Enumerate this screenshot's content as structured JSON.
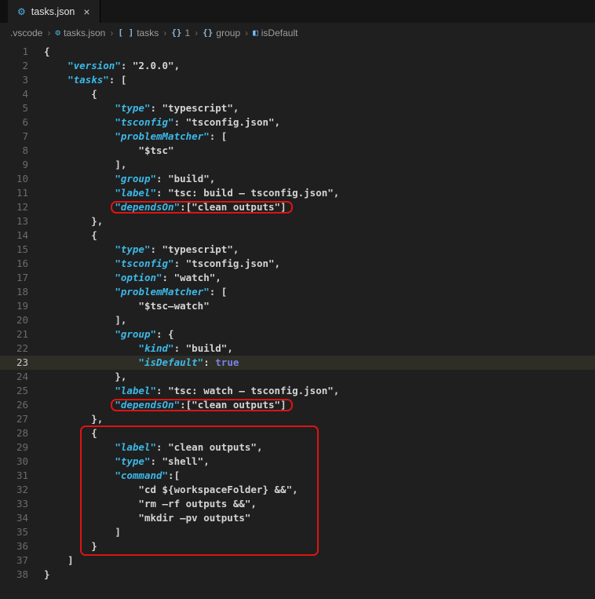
{
  "colors": {
    "background": "#1f1f1f",
    "tabbar_bg": "#161616",
    "tab_bg": "#1f1f1f",
    "key": "#3cb9e8",
    "text": "#d4d4d4",
    "keyword": "#7b82e4",
    "line_number": "#6b6b6b",
    "active_line_bg": "#2e2e27",
    "annotation": "#dd1414",
    "breadcrumb_text": "#9d9d9d"
  },
  "tab": {
    "label": "tasks.json",
    "close_glyph": "×",
    "icon_glyph": "⚙"
  },
  "breadcrumb": {
    "separator": "›",
    "items": [
      {
        "label": ".vscode",
        "icon": "",
        "icon_glyph": "",
        "icon_color": ""
      },
      {
        "label": "tasks.json",
        "icon": "json-file-icon",
        "icon_glyph": "⚙",
        "icon_color": "#4fb4e8"
      },
      {
        "label": "tasks",
        "icon": "symbol-array-icon",
        "icon_glyph": "[ ]",
        "icon_color": "#8ab6d6"
      },
      {
        "label": "1",
        "icon": "symbol-object-icon",
        "icon_glyph": "{}",
        "icon_color": "#8ab6d6"
      },
      {
        "label": "group",
        "icon": "symbol-object-icon",
        "icon_glyph": "{}",
        "icon_color": "#8ab6d6"
      },
      {
        "label": "isDefault",
        "icon": "symbol-boolean-icon",
        "icon_glyph": "◧",
        "icon_color": "#75beff"
      }
    ]
  },
  "editor": {
    "active_line": 23,
    "lines": [
      {
        "n": 1,
        "indent": 0,
        "segs": [
          [
            "p",
            "{"
          ]
        ]
      },
      {
        "n": 2,
        "indent": 4,
        "segs": [
          [
            "k",
            "\"version\""
          ],
          [
            "p",
            ": "
          ],
          [
            "s",
            "\"2.0.0\""
          ],
          [
            "p",
            ","
          ]
        ]
      },
      {
        "n": 3,
        "indent": 4,
        "segs": [
          [
            "k",
            "\"tasks\""
          ],
          [
            "p",
            ": ["
          ]
        ]
      },
      {
        "n": 4,
        "indent": 8,
        "segs": [
          [
            "p",
            "{"
          ]
        ]
      },
      {
        "n": 5,
        "indent": 12,
        "segs": [
          [
            "k",
            "\"type\""
          ],
          [
            "p",
            ": "
          ],
          [
            "s",
            "\"typescript\""
          ],
          [
            "p",
            ","
          ]
        ]
      },
      {
        "n": 6,
        "indent": 12,
        "segs": [
          [
            "k",
            "\"tsconfig\""
          ],
          [
            "p",
            ": "
          ],
          [
            "s",
            "\"tsconfig.json\""
          ],
          [
            "p",
            ","
          ]
        ]
      },
      {
        "n": 7,
        "indent": 12,
        "segs": [
          [
            "k",
            "\"problemMatcher\""
          ],
          [
            "p",
            ": ["
          ]
        ]
      },
      {
        "n": 8,
        "indent": 16,
        "segs": [
          [
            "s",
            "\"$tsc\""
          ]
        ]
      },
      {
        "n": 9,
        "indent": 12,
        "segs": [
          [
            "p",
            "],"
          ]
        ]
      },
      {
        "n": 10,
        "indent": 12,
        "segs": [
          [
            "k",
            "\"group\""
          ],
          [
            "p",
            ": "
          ],
          [
            "s",
            "\"build\""
          ],
          [
            "p",
            ","
          ]
        ]
      },
      {
        "n": 11,
        "indent": 12,
        "segs": [
          [
            "k",
            "\"label\""
          ],
          [
            "p",
            ": "
          ],
          [
            "s",
            "\"tsc: build — tsconfig.json\""
          ],
          [
            "p",
            ","
          ]
        ]
      },
      {
        "n": 12,
        "indent": 12,
        "segs": [
          [
            "k",
            "\"dependsOn\""
          ],
          [
            "p",
            ":["
          ],
          [
            "s",
            "\"clean outputs\""
          ],
          [
            "p",
            "]"
          ]
        ]
      },
      {
        "n": 13,
        "indent": 8,
        "segs": [
          [
            "p",
            "},"
          ]
        ]
      },
      {
        "n": 14,
        "indent": 8,
        "segs": [
          [
            "p",
            "{"
          ]
        ]
      },
      {
        "n": 15,
        "indent": 12,
        "segs": [
          [
            "k",
            "\"type\""
          ],
          [
            "p",
            ": "
          ],
          [
            "s",
            "\"typescript\""
          ],
          [
            "p",
            ","
          ]
        ]
      },
      {
        "n": 16,
        "indent": 12,
        "segs": [
          [
            "k",
            "\"tsconfig\""
          ],
          [
            "p",
            ": "
          ],
          [
            "s",
            "\"tsconfig.json\""
          ],
          [
            "p",
            ","
          ]
        ]
      },
      {
        "n": 17,
        "indent": 12,
        "segs": [
          [
            "k",
            "\"option\""
          ],
          [
            "p",
            ": "
          ],
          [
            "s",
            "\"watch\""
          ],
          [
            "p",
            ","
          ]
        ]
      },
      {
        "n": 18,
        "indent": 12,
        "segs": [
          [
            "k",
            "\"problemMatcher\""
          ],
          [
            "p",
            ": ["
          ]
        ]
      },
      {
        "n": 19,
        "indent": 16,
        "segs": [
          [
            "s",
            "\"$tsc—watch\""
          ]
        ]
      },
      {
        "n": 20,
        "indent": 12,
        "segs": [
          [
            "p",
            "],"
          ]
        ]
      },
      {
        "n": 21,
        "indent": 12,
        "segs": [
          [
            "k",
            "\"group\""
          ],
          [
            "p",
            ": {"
          ]
        ]
      },
      {
        "n": 22,
        "indent": 16,
        "segs": [
          [
            "k",
            "\"kind\""
          ],
          [
            "p",
            ": "
          ],
          [
            "s",
            "\"build\""
          ],
          [
            "p",
            ","
          ]
        ]
      },
      {
        "n": 23,
        "indent": 16,
        "segs": [
          [
            "k",
            "\"isDefault\""
          ],
          [
            "p",
            ": "
          ],
          [
            "w",
            "true"
          ]
        ]
      },
      {
        "n": 24,
        "indent": 12,
        "segs": [
          [
            "p",
            "},"
          ]
        ]
      },
      {
        "n": 25,
        "indent": 12,
        "segs": [
          [
            "k",
            "\"label\""
          ],
          [
            "p",
            ": "
          ],
          [
            "s",
            "\"tsc: watch — tsconfig.json\""
          ],
          [
            "p",
            ","
          ]
        ]
      },
      {
        "n": 26,
        "indent": 12,
        "segs": [
          [
            "k",
            "\"dependsOn\""
          ],
          [
            "p",
            ":["
          ],
          [
            "s",
            "\"clean outputs\""
          ],
          [
            "p",
            "]"
          ]
        ]
      },
      {
        "n": 27,
        "indent": 8,
        "segs": [
          [
            "p",
            "},"
          ]
        ]
      },
      {
        "n": 28,
        "indent": 8,
        "segs": [
          [
            "p",
            "{"
          ]
        ]
      },
      {
        "n": 29,
        "indent": 12,
        "segs": [
          [
            "k",
            "\"label\""
          ],
          [
            "p",
            ": "
          ],
          [
            "s",
            "\"clean outputs\""
          ],
          [
            "p",
            ","
          ]
        ]
      },
      {
        "n": 30,
        "indent": 12,
        "segs": [
          [
            "k",
            "\"type\""
          ],
          [
            "p",
            ": "
          ],
          [
            "s",
            "\"shell\""
          ],
          [
            "p",
            ","
          ]
        ]
      },
      {
        "n": 31,
        "indent": 12,
        "segs": [
          [
            "k",
            "\"command\""
          ],
          [
            "p",
            ":["
          ]
        ]
      },
      {
        "n": 32,
        "indent": 16,
        "segs": [
          [
            "s",
            "\"cd ${workspaceFolder} &&\""
          ],
          [
            "p",
            ","
          ]
        ]
      },
      {
        "n": 33,
        "indent": 16,
        "segs": [
          [
            "s",
            "\"rm —rf outputs &&\""
          ],
          [
            "p",
            ","
          ]
        ]
      },
      {
        "n": 34,
        "indent": 16,
        "segs": [
          [
            "s",
            "\"mkdir —pv outputs\""
          ]
        ]
      },
      {
        "n": 35,
        "indent": 12,
        "segs": [
          [
            "p",
            "]"
          ]
        ]
      },
      {
        "n": 36,
        "indent": 8,
        "segs": [
          [
            "p",
            "}"
          ]
        ]
      },
      {
        "n": 37,
        "indent": 4,
        "segs": [
          [
            "p",
            "]"
          ]
        ]
      },
      {
        "n": 38,
        "indent": 0,
        "segs": [
          [
            "p",
            "}"
          ]
        ]
      }
    ],
    "annotations": [
      {
        "from": 12,
        "to": 12,
        "style": "inline"
      },
      {
        "from": 26,
        "to": 26,
        "style": "inline"
      },
      {
        "from": 28,
        "to": 36,
        "style": "block"
      }
    ]
  }
}
